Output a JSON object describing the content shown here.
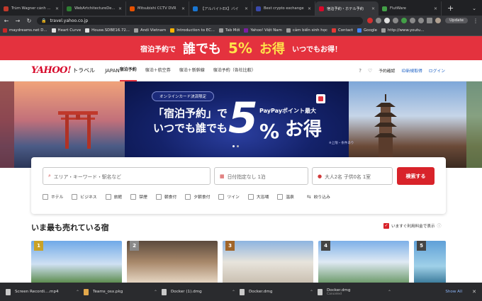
{
  "browser": {
    "tabs": [
      {
        "title": "Trùm Wagner cảnh báo",
        "color": "#c0392b"
      },
      {
        "title": "WebArtchitectureDesign",
        "color": "#2e7d32"
      },
      {
        "title": "Mitsubishi CCTV DVR",
        "color": "#e65100"
      },
      {
        "title": "【アルバイトEX】バイ",
        "color": "#1976d2"
      },
      {
        "title": "Best crypto exchange",
        "color": "#3949ab"
      },
      {
        "title": "宿泊予約・ホテル予約",
        "color": "#d70a2b",
        "active": true
      },
      {
        "title": "FlutWare",
        "color": "#43a047"
      }
    ],
    "url": "travel.yahoo.co.jp",
    "update_label": "Update",
    "bookmarks": [
      {
        "label": "maydreams.net D...",
        "color": "#c62828"
      },
      {
        "label": "Heart Curve",
        "color": "#e0e0e0"
      },
      {
        "label": "House.SDBE16.72...",
        "color": "#e0e0e0"
      },
      {
        "label": "Andi Vietnam",
        "color": "#9e9e9e"
      },
      {
        "label": "Introduction to EC...",
        "color": "#ffb300"
      },
      {
        "label": "Tab Mới",
        "color": "#9e9e9e"
      },
      {
        "label": "Yahoo! Việt Nam",
        "color": "#7b1fa2"
      },
      {
        "label": "cảm biến sinh học",
        "color": "#9e9e9e"
      },
      {
        "label": "Contact",
        "color": "#e53935"
      },
      {
        "label": "Google",
        "color": "#4285f4"
      },
      {
        "label": "http://www.youtu...",
        "color": "#9e9e9e"
      }
    ]
  },
  "promo": {
    "part1": "宿泊予約で",
    "part2": "誰でも",
    "pct": "5%",
    "part3": "お得",
    "part4": "いつでもお得！"
  },
  "header": {
    "logo": "YAHOO!",
    "logo_sub": "トラベル",
    "logo_jp": "JAPAN",
    "nav": [
      {
        "label": "宿泊予約",
        "active": true
      },
      {
        "label": "宿泊＋航空券"
      },
      {
        "label": "宿泊＋新幹線"
      },
      {
        "label": "宿泊予約（各社比較）"
      }
    ],
    "reservation_check": "予約確認",
    "register": "ID新規取得",
    "login": "ログイン"
  },
  "hero": {
    "tag": "オンラインカード決済限定",
    "line1": "「宿泊予約」で",
    "line2": "いつでも誰でも",
    "big_num": "5",
    "paypay": "PayPayポイント最大",
    "pct": "%",
    "deal": "お得",
    "note": "※上限・条件あり"
  },
  "search": {
    "keyword_placeholder": "エリア・キーワード・駅名など",
    "date_placeholder": "日付指定なし 1泊",
    "guests_placeholder": "大人2名 子供0名 1室",
    "search_button": "検索する",
    "filters": [
      "ホテル",
      "ビジネス",
      "旅館",
      "禁煙",
      "朝食付",
      "夕朝食付",
      "ツイン",
      "大浴場",
      "温泉"
    ],
    "narrow": "絞り込み"
  },
  "ranking": {
    "title": "いま最も売れている宿",
    "price_toggle": "いますぐ利用料金で表示",
    "cards": [
      {
        "rank": "1",
        "color": "#c9a227"
      },
      {
        "rank": "2",
        "color": "#8a8a8a"
      },
      {
        "rank": "3",
        "color": "#a0652a"
      },
      {
        "rank": "4",
        "color": "#444444"
      },
      {
        "rank": "5",
        "color": "#444444"
      }
    ]
  },
  "downloads": {
    "items": [
      {
        "name": "Screen Recordi....mp4",
        "type": "file"
      },
      {
        "name": "Teams_osx.pkg",
        "type": "pkg"
      },
      {
        "name": "Docker (1).dmg",
        "type": "file"
      },
      {
        "name": "Docker.dmg",
        "type": "file"
      },
      {
        "name": "Docker.dmg",
        "type": "file",
        "status": "Canceled"
      }
    ],
    "show_all": "Show All"
  }
}
